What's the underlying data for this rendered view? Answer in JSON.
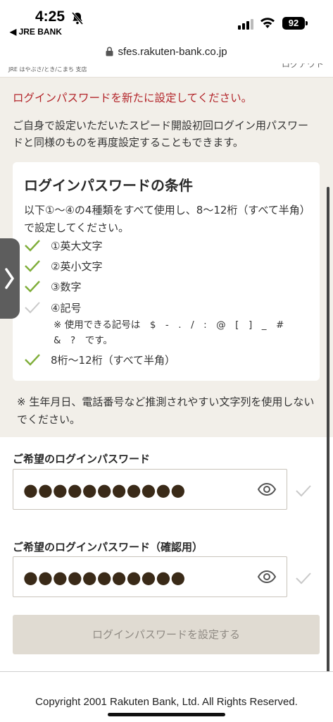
{
  "status_bar": {
    "time": "4:25",
    "back_app": "◀ JRE BANK",
    "battery": "92"
  },
  "browser": {
    "url": "sfes.rakuten-bank.co.jp"
  },
  "header": {
    "branch": "JRE はやぶさ/とき/こまち 支店",
    "logout": "ログアウト"
  },
  "main": {
    "error": "ログインパスワードを新たに設定してください。",
    "intro": "ご自身で設定いただいたスピード開設初回ログイン用パスワードと同様のものを再度設定することもできます。",
    "conditions": {
      "title": "ログインパスワードの条件",
      "description": "以下①～④の4種類をすべて使用し、8～12桁（すべて半角）で設定してください。",
      "items": [
        {
          "label": "①英大文字",
          "met": true
        },
        {
          "label": "②英小文字",
          "met": true
        },
        {
          "label": "③数字",
          "met": true
        },
        {
          "label": "④記号",
          "met": false
        },
        {
          "label": "8桁～12桁（すべて半角）",
          "met": true
        }
      ],
      "symbols_note": "※ 使用できる記号は　$　-　.　/　:　@　[　]　_　#　&　?　です。"
    },
    "warning": "※ 生年月日、電話番号など推測されやすい文字列を使用しないでください。"
  },
  "form": {
    "password_label": "ご希望のログインパスワード",
    "password_value": "●●●●●●●●●●●",
    "confirm_label": "ご希望のログインパスワード（確認用）",
    "confirm_value": "●●●●●●●●●●●",
    "submit_label": "ログインパスワードを設定する"
  },
  "footer": {
    "copyright": "Copyright 2001 Rakuten Bank, Ltd. All Rights Reserved."
  },
  "colors": {
    "accent_error": "#b3252a",
    "check_green": "#7fae3a",
    "background": "#f2efe9",
    "button_disabled": "#e0dbd2"
  }
}
